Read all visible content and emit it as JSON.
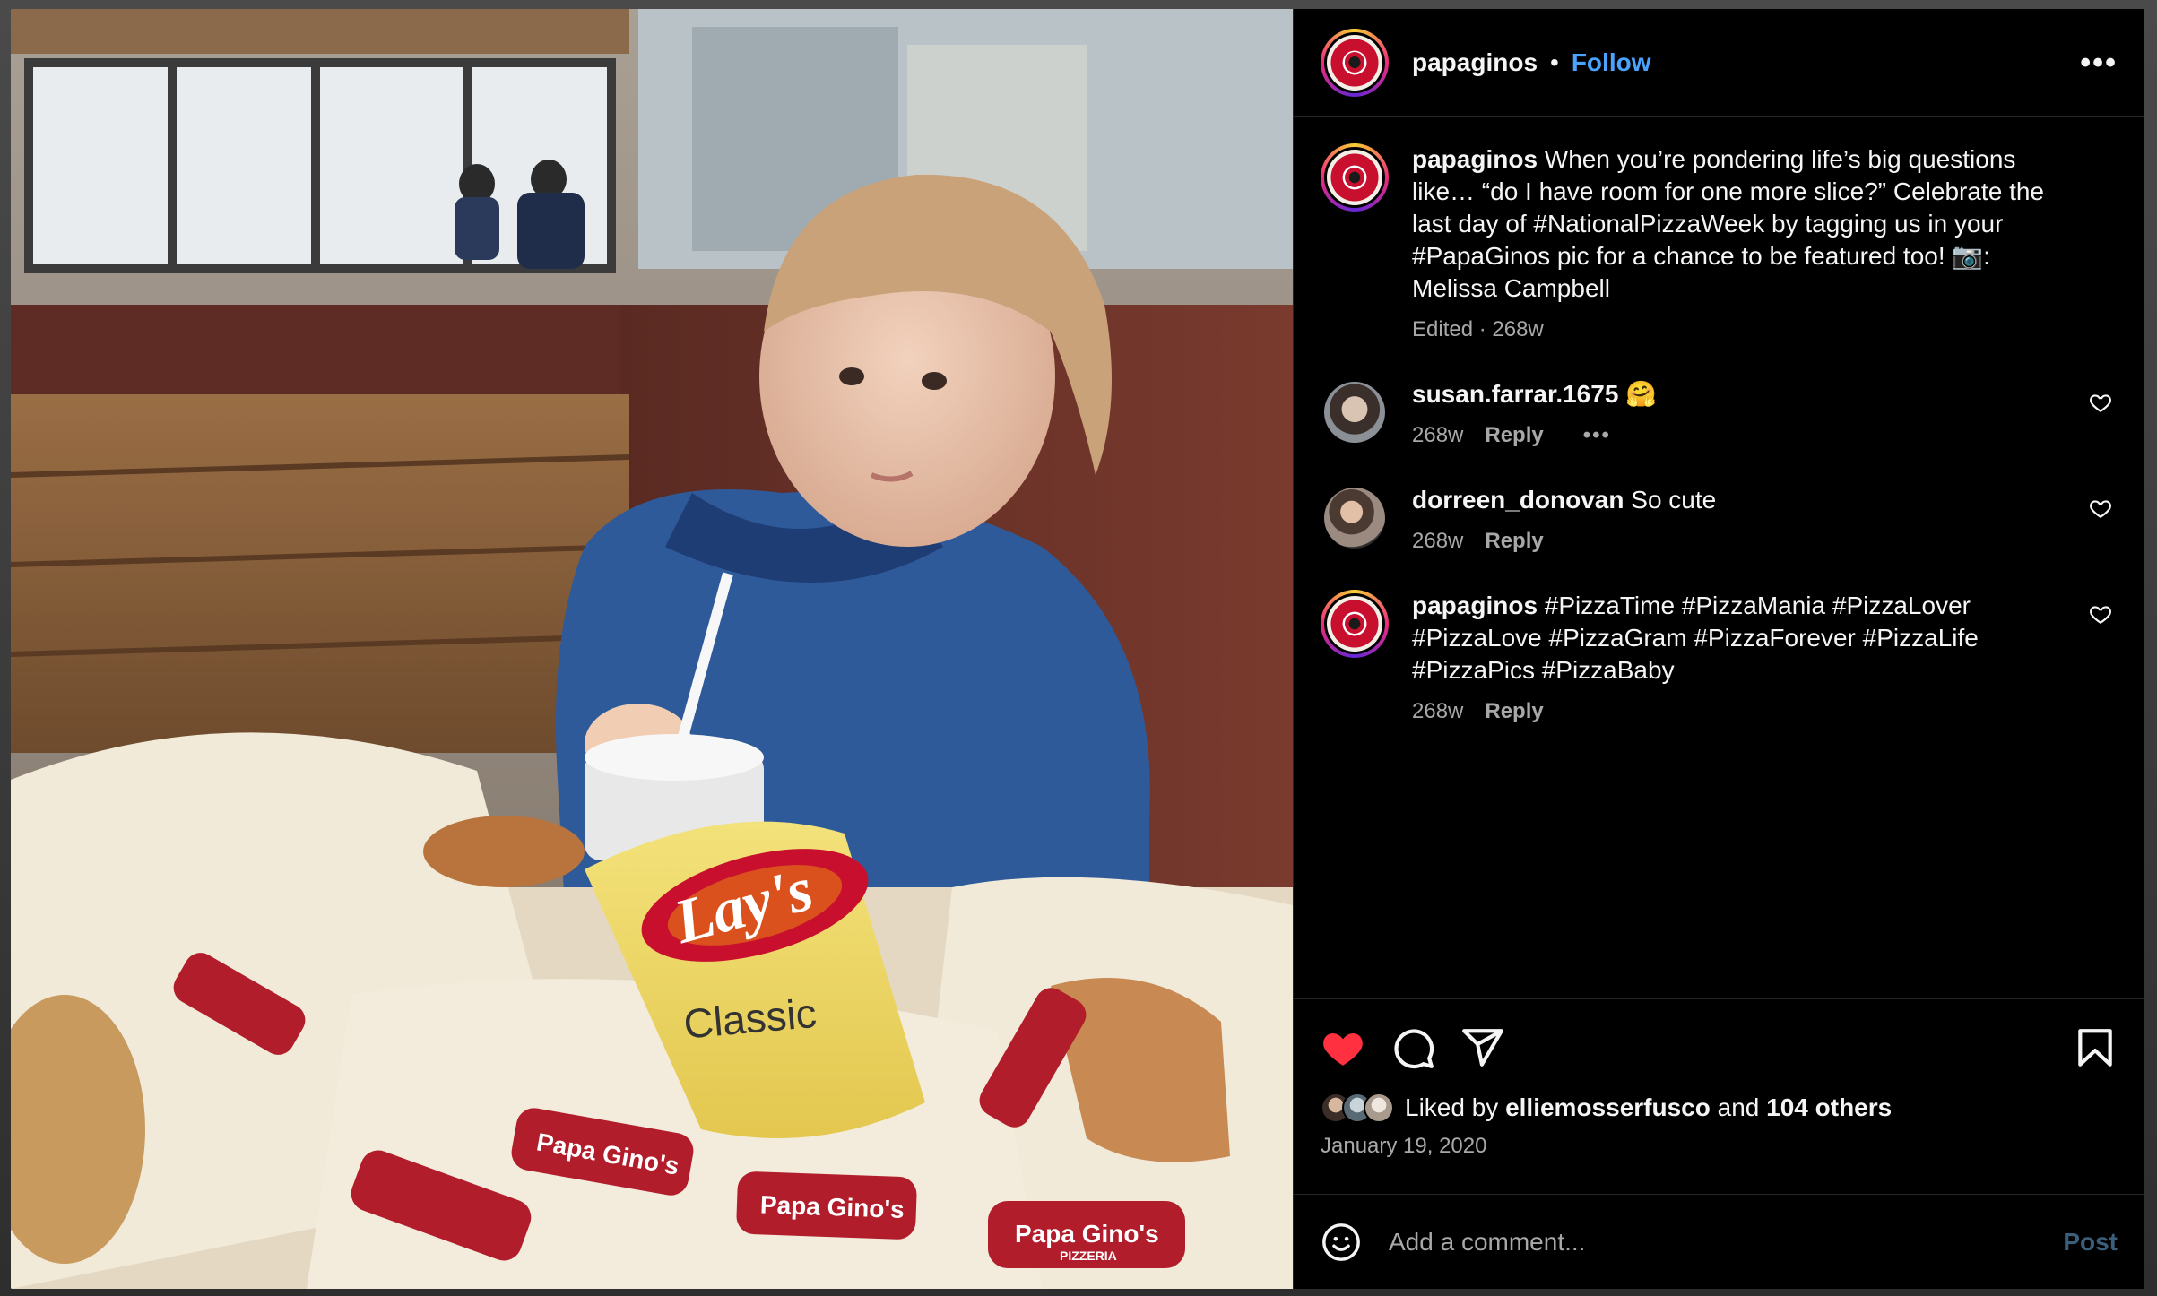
{
  "post": {
    "username": "papaginos",
    "separator": "•",
    "follow_label": "Follow",
    "more_label": "•••",
    "photo_text": {
      "chip_brand": "Lay's",
      "chip_flavor": "Classic",
      "wrapper_brand": "Papa Gino's",
      "wrapper_sub": "PIZZERIA"
    }
  },
  "caption": {
    "username": "papaginos",
    "text": "When you’re pondering life’s big questions like… “do I have room for one more slice?” Celebrate the last day of #NationalPizzaWeek by tagging us in your #PapaGinos pic for a chance to be featured too! 📷: Melissa Campbell",
    "meta": "Edited · 268w"
  },
  "comments": [
    {
      "username": "susan.farrar.1675",
      "text": "🤗",
      "time": "268w",
      "reply_label": "Reply",
      "more_label": "•••"
    },
    {
      "username": "dorreen_donovan",
      "text": "So cute",
      "time": "268w",
      "reply_label": "Reply"
    },
    {
      "username": "papaginos",
      "text": "#PizzaTime #PizzaMania #PizzaLover #PizzaLove #PizzaGram #PizzaForever #PizzaLife #PizzaPics #PizzaBaby",
      "time": "268w",
      "reply_label": "Reply"
    }
  ],
  "actions": {
    "icons": [
      "heart-filled-icon",
      "comment-icon",
      "share-icon",
      "bookmark-icon"
    ],
    "liked": true,
    "like_color": "#ff3040",
    "liked_prefix": "Liked by",
    "liked_user": "elliemosserfusco",
    "liked_and": "and",
    "liked_others": "104 others",
    "date": "January 19, 2020"
  },
  "comment_box": {
    "placeholder": "Add a comment...",
    "post_label": "Post",
    "emoji_icon": "smiley-icon"
  }
}
